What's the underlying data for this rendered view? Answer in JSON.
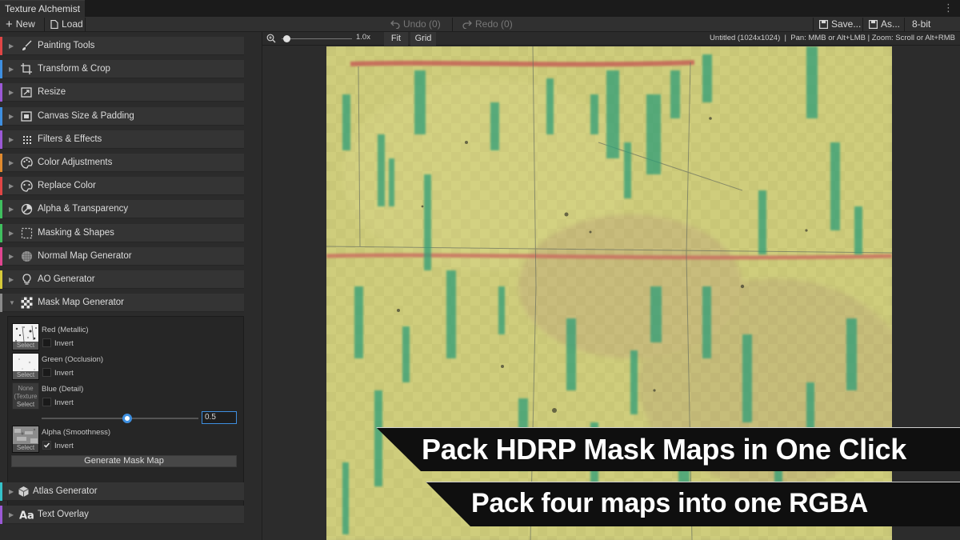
{
  "window": {
    "title": "Texture Alchemist",
    "menu_glyph": "⋮"
  },
  "toolbar": {
    "new_label": "New",
    "load_label": "Load",
    "undo_label": "Undo (0)",
    "redo_label": "Redo (0)",
    "save_label": "Save...",
    "save_as_label": "As...",
    "bit_depth": "8-bit"
  },
  "viewbar": {
    "zoom_value": "1.0x",
    "fit_label": "Fit",
    "grid_label": "Grid",
    "status": "Untitled (1024x1024)  |  Pan: MMB or Alt+LMB | Zoom: Scroll or Alt+RMB"
  },
  "sidebar": {
    "sections": [
      {
        "label": "Painting Tools",
        "color": "#e04545",
        "icon": "brush-icon"
      },
      {
        "label": "Transform & Crop",
        "color": "#3e8fe0",
        "icon": "crop-icon"
      },
      {
        "label": "Resize",
        "color": "#9b59d6",
        "icon": "resize-icon"
      },
      {
        "label": "Canvas Size & Padding",
        "color": "#3e8fe0",
        "icon": "canvas-icon"
      },
      {
        "label": "Filters & Effects",
        "color": "#9b59d6",
        "icon": "filter-icon"
      },
      {
        "label": "Color Adjustments",
        "color": "#e08a2e",
        "icon": "palette-icon"
      },
      {
        "label": "Replace Color",
        "color": "#e04545",
        "icon": "replace-icon"
      },
      {
        "label": "Alpha & Transparency",
        "color": "#3fbf5f",
        "icon": "alpha-icon"
      },
      {
        "label": "Masking & Shapes",
        "color": "#3fbf5f",
        "icon": "mask-icon"
      },
      {
        "label": "Normal Map Generator",
        "color": "#e04590",
        "icon": "normal-icon"
      },
      {
        "label": "AO Generator",
        "color": "#d6c93a",
        "icon": "bulb-icon"
      },
      {
        "label": "Mask Map Generator",
        "color": "#8a8a8a",
        "icon": "checker-icon"
      }
    ],
    "bottom_sections": [
      {
        "label": "Atlas Generator",
        "color": "#35c2c9",
        "icon": "cube-icon"
      },
      {
        "label": "Text Overlay",
        "color": "#9b59d6",
        "icon": "text-icon"
      }
    ],
    "mask_map": {
      "red_label": "Red (Metallic)",
      "green_label": "Green (Occlusion)",
      "blue_label": "Blue (Detail)",
      "alpha_label": "Alpha (Smoothness)",
      "invert_label": "Invert",
      "select_label": "Select",
      "none_label": "None",
      "none_sub": "(Texture",
      "blue_value": "0.5",
      "blue_fraction": 0.5,
      "alpha_invert_checked": true,
      "generate_label": "Generate Mask Map"
    }
  },
  "banners": {
    "headline": "Pack HDRP Mask Maps in One Click",
    "subline": "Pack four maps into one RGBA"
  },
  "colors": {
    "texture_base": "#c8c67a",
    "texture_green": "#2f9e78",
    "texture_red": "#c0504d",
    "accent": "#3e8fe0"
  }
}
